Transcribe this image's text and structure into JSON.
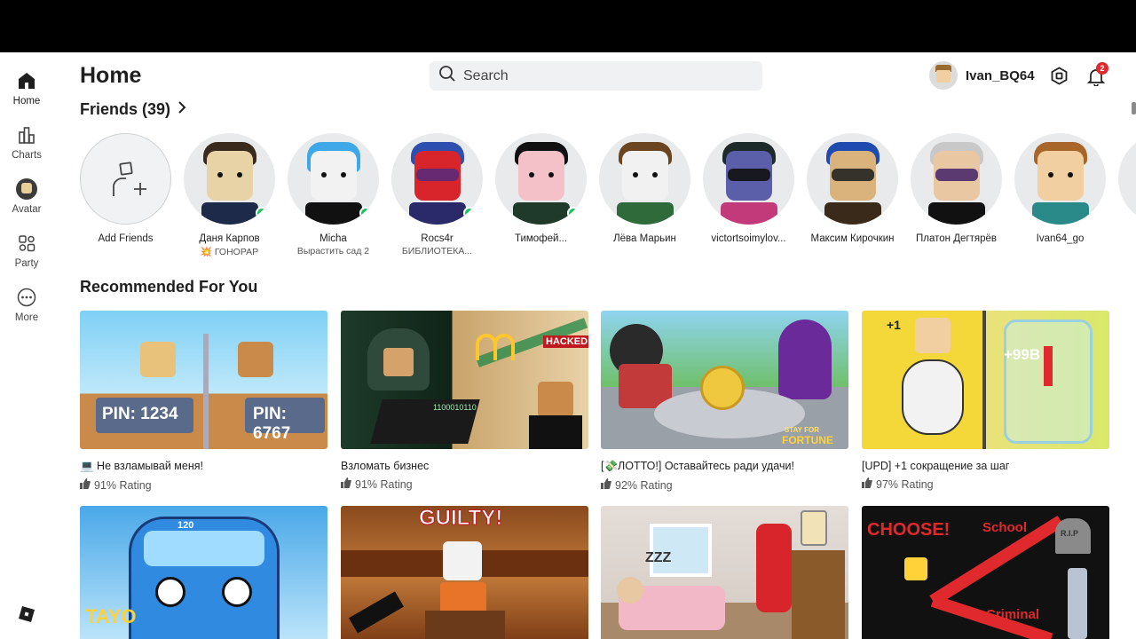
{
  "sidebar": {
    "items": [
      {
        "label": "Home",
        "icon": "home-icon"
      },
      {
        "label": "Charts",
        "icon": "charts-icon"
      },
      {
        "label": "Avatar",
        "icon": "avatar-icon"
      },
      {
        "label": "Party",
        "icon": "party-icon"
      },
      {
        "label": "More",
        "icon": "more-icon"
      }
    ]
  },
  "header": {
    "title": "Home",
    "search_placeholder": "Search",
    "username": "Ivan_BQ64",
    "notification_count": "2"
  },
  "friends": {
    "title": "Friends (39)",
    "items": [
      {
        "name": "Add Friends",
        "status": ""
      },
      {
        "name": "Даня Карпов",
        "status": "💥 ГОНОРАР",
        "online": true
      },
      {
        "name": "Micha",
        "status": "Вырастить сад 2",
        "online": true
      },
      {
        "name": "Rocs4r",
        "status": "БИБЛИОТЕКА...",
        "online": true
      },
      {
        "name": "Тимофей...",
        "status": "",
        "online": true
      },
      {
        "name": "Лёва Марьин",
        "status": "",
        "online": false
      },
      {
        "name": "victortsoimylov...",
        "status": "",
        "online": false
      },
      {
        "name": "Максим Кирочкин",
        "status": "",
        "online": false
      },
      {
        "name": "Платон Дегтярёв",
        "status": "",
        "online": false
      },
      {
        "name": "Ivan64_go",
        "status": "",
        "online": false
      }
    ]
  },
  "recommended": {
    "title": "Recommended For You",
    "cards": [
      {
        "title": "💻 Не взламывай меня!",
        "rating": "91% Rating",
        "art": {
          "text1": "PIN: 1234",
          "text2": "PIN: 6767"
        }
      },
      {
        "title": "Взломать бизнес",
        "rating": "91% Rating",
        "art": {
          "text1": "HACKED",
          "text2": "1100010110"
        }
      },
      {
        "title": "[💸ЛОТТО!] Оставайтесь ради удачи!",
        "rating": "92% Rating",
        "art": {
          "text1": "STAY FOR",
          "text2": "FORTUNE"
        }
      },
      {
        "title": "[UPD] +1 сокращение за шаг",
        "rating": "97% Rating",
        "art": {
          "text1": "+99B",
          "text2": "+1"
        }
      },
      {
        "title": "",
        "rating": "",
        "art": {
          "text1": "120",
          "text2": "TAYO"
        }
      },
      {
        "title": "",
        "rating": "",
        "art": {
          "text1": "GUILTY!",
          "text2": ""
        }
      },
      {
        "title": "",
        "rating": "",
        "art": {
          "text1": "ZZZ",
          "text2": ""
        }
      },
      {
        "title": "",
        "rating": "",
        "art": {
          "text1": "CHOOSE!",
          "text2": "School",
          "text3": "Criminal",
          "text4": "R.I.P"
        }
      }
    ]
  },
  "colors": {
    "online": "#19c262",
    "badge": "#e0292c",
    "search_bg": "#f0f1f2"
  }
}
